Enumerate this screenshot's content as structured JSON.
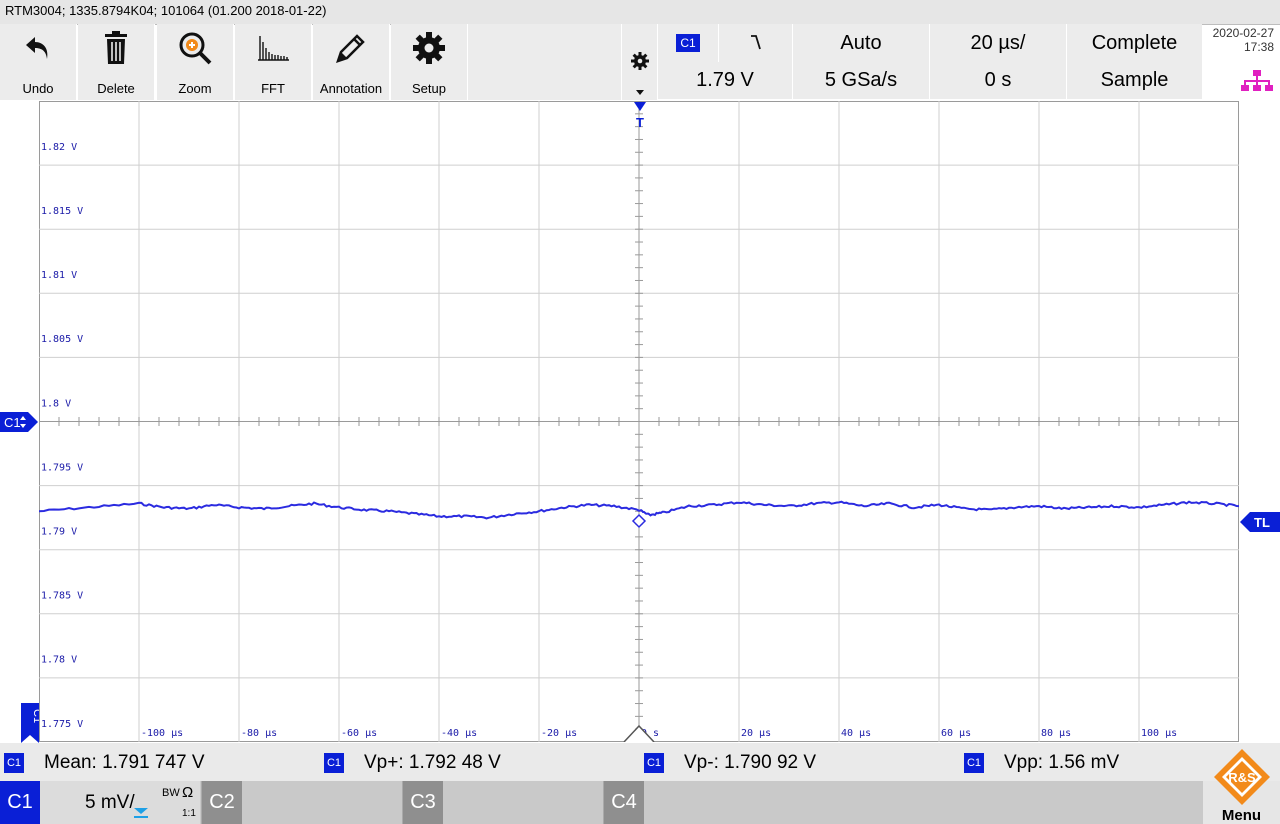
{
  "title": "RTM3004; 1335.8794K04; 101064 (01.200 2018-01-22)",
  "toolbar": {
    "buttons": [
      {
        "label": "Undo",
        "icon": "undo-icon"
      },
      {
        "label": "Delete",
        "icon": "trash-icon"
      },
      {
        "label": "Zoom",
        "icon": "zoom-in-icon"
      },
      {
        "label": "FFT",
        "icon": "fft-spectrum-icon"
      },
      {
        "label": "Annotation",
        "icon": "pencil-icon"
      },
      {
        "label": "Setup",
        "icon": "gear-icon"
      }
    ]
  },
  "trigger": {
    "source": "C1",
    "slope_icon": "falling-edge-icon",
    "mode": "Auto",
    "level": "1.79 V",
    "sample_rate": "5 GSa/s",
    "timebase": "20 µs/",
    "position": "0 s",
    "acq_state": "Complete",
    "acq_mode": "Sample"
  },
  "datetime": {
    "date": "2020-02-27",
    "time": "17:38"
  },
  "status_icon": "network-icon",
  "y_labels": [
    "1.82 V",
    "1.815 V",
    "1.81 V",
    "1.805 V",
    "1.8 V",
    "1.795 V",
    "1.79 V",
    "1.785 V",
    "1.78 V",
    "1.775 V"
  ],
  "x_labels": [
    "-100 µs",
    "-80 µs",
    "-60 µs",
    "-40 µs",
    "-20 µs",
    "0 s",
    "20 µs",
    "40 µs",
    "60 µs",
    "80 µs",
    "100 µs"
  ],
  "markers": {
    "channel": "C1",
    "trigger_level": "TL",
    "trigger_pos": "T"
  },
  "chart_data": {
    "type": "line",
    "title": "",
    "xlabel": "",
    "ylabel": "",
    "xlim": [
      -120,
      120
    ],
    "ylim": [
      1.7735,
      1.8235
    ],
    "series": [
      {
        "name": "C1",
        "color": "#2b2be0",
        "x": [
          -120,
          -110,
          -100,
          -95,
          -90,
          -85,
          -80,
          -75,
          -70,
          -65,
          -60,
          -55,
          -50,
          -45,
          -40,
          -35,
          -30,
          -25,
          -20,
          -15,
          -10,
          -5,
          0,
          2,
          5,
          10,
          15,
          20,
          25,
          30,
          35,
          40,
          45,
          50,
          55,
          60,
          65,
          70,
          75,
          80,
          85,
          90,
          95,
          100,
          105,
          110,
          115,
          120
        ],
        "y": [
          1.7915,
          1.7918,
          1.7921,
          1.7918,
          1.7917,
          1.792,
          1.7918,
          1.7917,
          1.7919,
          1.7921,
          1.7918,
          1.7916,
          1.7915,
          1.7913,
          1.7911,
          1.7911,
          1.791,
          1.7913,
          1.7915,
          1.7918,
          1.792,
          1.7919,
          1.7916,
          1.7912,
          1.7914,
          1.7919,
          1.792,
          1.7922,
          1.792,
          1.7919,
          1.7921,
          1.7922,
          1.7919,
          1.7921,
          1.7918,
          1.792,
          1.7917,
          1.7916,
          1.7918,
          1.7919,
          1.7917,
          1.7918,
          1.7919,
          1.7918,
          1.792,
          1.7922,
          1.7921,
          1.7919
        ]
      }
    ]
  },
  "measurements": [
    {
      "ch": "C1",
      "text": "Mean: 1.791 747 V"
    },
    {
      "ch": "C1",
      "text": "Vp+: 1.792 48 V"
    },
    {
      "ch": "C1",
      "text": "Vp-: 1.790 92 V"
    },
    {
      "ch": "C1",
      "text": "Vpp: 1.56 mV"
    }
  ],
  "channels": {
    "c1": {
      "label": "C1",
      "scale": "5 mV/",
      "bw": "BW",
      "ohm": "Ω",
      "ratio": "1:1",
      "color": "#0a1fd6"
    },
    "c2": {
      "label": "C2"
    },
    "c3": {
      "label": "C3"
    },
    "c4": {
      "label": "C4"
    },
    "menu": "Menu"
  },
  "logo_text": "R&S"
}
